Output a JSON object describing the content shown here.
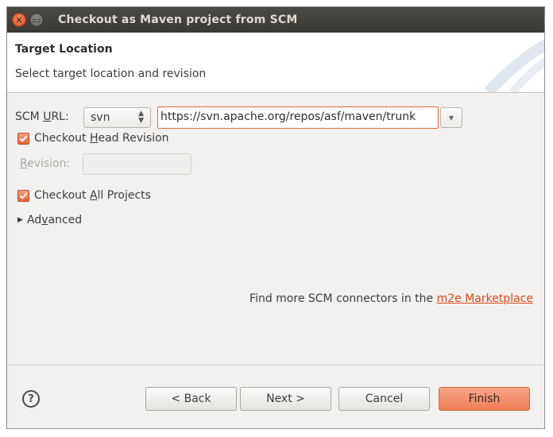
{
  "window": {
    "title": "Checkout as Maven project from SCM"
  },
  "header": {
    "title": "Target Location",
    "description": "Select target location and revision"
  },
  "form": {
    "scm_url_label_pre": "SCM ",
    "scm_url_label_u": "U",
    "scm_url_label_post": "RL:",
    "scm_type_value": "svn",
    "url_value": "https://svn.apache.org/repos/asf/maven/trunk",
    "head_revision_label_pre": "Checkout ",
    "head_revision_label_u": "H",
    "head_revision_label_post": "ead Revision",
    "head_revision_checked": true,
    "revision_label_u": "R",
    "revision_label_post": "evision:",
    "revision_value": "",
    "all_projects_label_pre": "Checkout ",
    "all_projects_label_u": "A",
    "all_projects_label_post": "ll Projects",
    "all_projects_checked": true,
    "advanced_label_pre": "Ad",
    "advanced_label_u": "v",
    "advanced_label_post": "anced",
    "marketplace_text": "Find more SCM connectors in the ",
    "marketplace_link": "m2e Marketplace"
  },
  "buttons": {
    "help": "?",
    "back": "< Back",
    "next": "Next >",
    "cancel": "Cancel",
    "finish": "Finish"
  },
  "colors": {
    "accent": "#e3643a",
    "link": "#dd4814",
    "titlebar": "#3c3b37"
  }
}
